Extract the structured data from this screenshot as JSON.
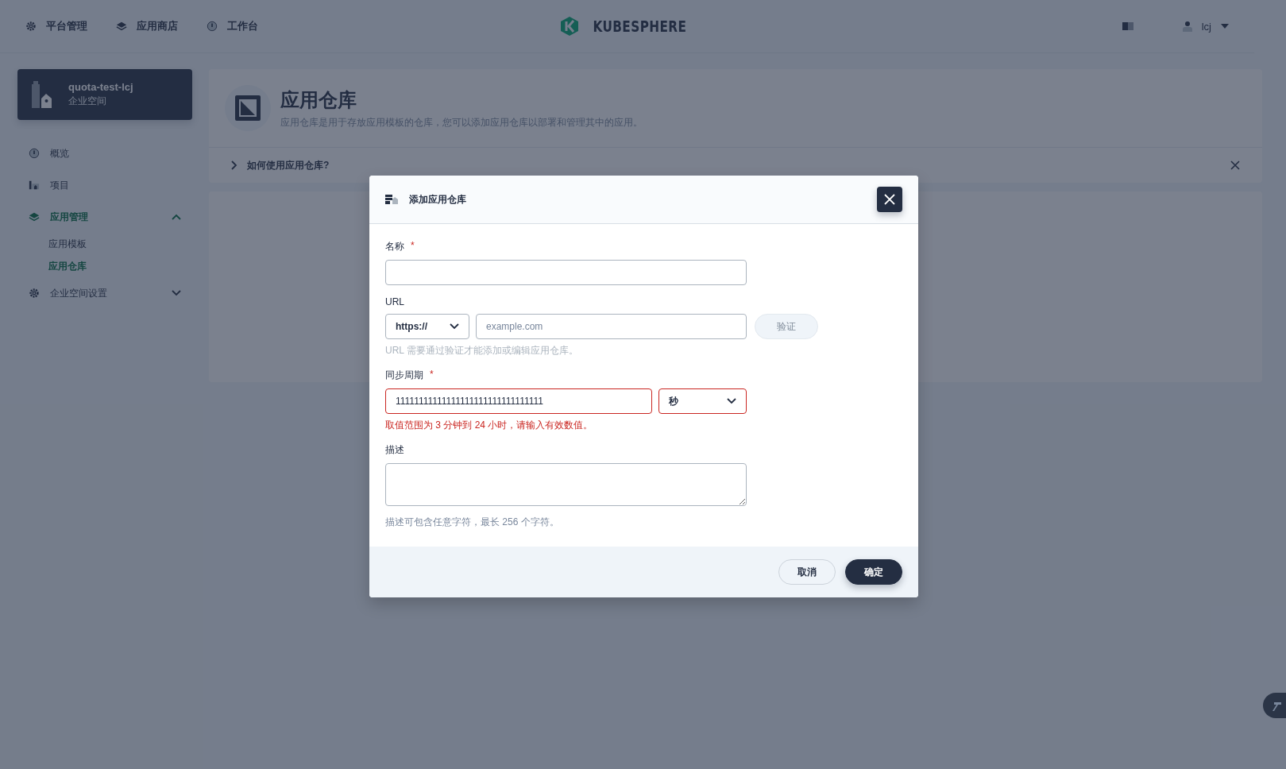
{
  "top_nav": {
    "items": [
      {
        "label": "平台管理",
        "kind": "gear"
      },
      {
        "label": "应用商店",
        "kind": "layers"
      },
      {
        "label": "工作台",
        "kind": "dashboard"
      }
    ],
    "logo": "KUBESPHERE",
    "user": "lcj"
  },
  "workspace": {
    "name": "quota-test-lcj",
    "type": "企业空间"
  },
  "sidebar": {
    "items": [
      {
        "label": "概览",
        "kind": "dashboard",
        "selected": false
      },
      {
        "label": "项目",
        "kind": "project",
        "selected": false
      },
      {
        "label": "应用管理",
        "kind": "layers",
        "selected": true,
        "expanded": true,
        "children": [
          {
            "label": "应用模板",
            "selected": false
          },
          {
            "label": "应用仓库",
            "selected": true
          }
        ]
      },
      {
        "label": "企业空间设置",
        "kind": "gear",
        "selected": false,
        "expanded": false
      }
    ]
  },
  "page": {
    "title": "应用仓库",
    "description": "应用仓库是用于存放应用模板的仓库，您可以添加应用仓库以部署和管理其中的应用。",
    "help": "如何使用应用仓库?"
  },
  "dialog": {
    "title": "添加应用仓库",
    "name_field": {
      "label": "名称",
      "required_mark": "*"
    },
    "url_field": {
      "label": "URL",
      "protocol": "https://",
      "placeholder": "example.com",
      "verify_button": "验证",
      "hint": "URL 需要通过验证才能添加或编辑应用仓库。"
    },
    "sync_field": {
      "label": "同步周期",
      "required_mark": "*",
      "value": "11111111111111111111111111111111",
      "unit": "秒",
      "invalid": true,
      "error": "取值范围为 3 分钟到 24 小时，请输入有效数值。"
    },
    "description_field": {
      "label": "描述",
      "hint": "描述可包含任意字符，最长 256 个字符。"
    },
    "buttons": {
      "cancel": "取消",
      "ok": "确定"
    }
  }
}
